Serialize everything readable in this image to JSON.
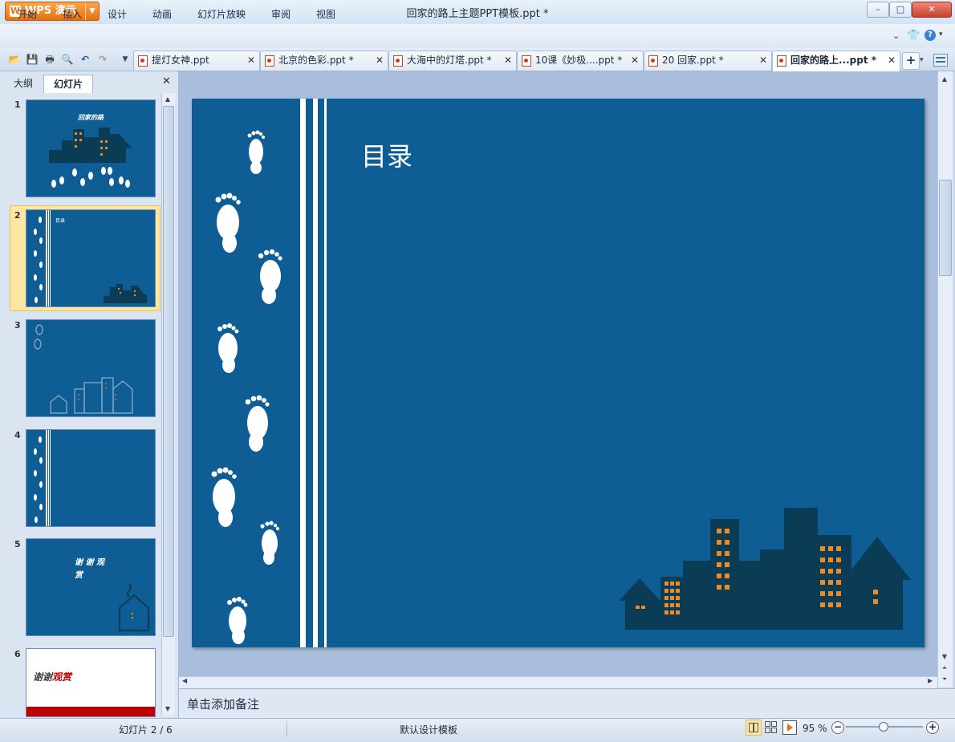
{
  "app": {
    "name": "WPS 演示",
    "window_title": "回家的路上主题PPT模板.ppt *"
  },
  "window_buttons": {
    "minimize": "–",
    "maximize": "□",
    "close": "✕"
  },
  "menu": [
    "开始",
    "插入",
    "设计",
    "动画",
    "幻灯片放映",
    "审阅",
    "视图"
  ],
  "doc_tabs": [
    {
      "label": "提灯女神.ppt",
      "active": false
    },
    {
      "label": "北京的色彩.ppt *",
      "active": false
    },
    {
      "label": "大海中的灯塔.ppt *",
      "active": false
    },
    {
      "label": "10课《妙极....ppt *",
      "active": false
    },
    {
      "label": "20 回家.ppt *",
      "active": false
    },
    {
      "label": "回家的路上...ppt *",
      "active": true
    }
  ],
  "panel": {
    "tab_outline": "大纲",
    "tab_slides": "幻灯片"
  },
  "thumbnails": [
    {
      "num": "1",
      "text": "回家的路"
    },
    {
      "num": "2",
      "text": "目录"
    },
    {
      "num": "3",
      "text": ""
    },
    {
      "num": "4",
      "text": ""
    },
    {
      "num": "5",
      "text": "谢 谢 观 赏"
    },
    {
      "num": "6",
      "text_plain": "谢谢",
      "text_accent": "观赏"
    }
  ],
  "selected_slide": 2,
  "slide": {
    "title": "目录"
  },
  "notes": {
    "placeholder": "单击添加备注"
  },
  "status": {
    "slide_count": "幻灯片 2 / 6",
    "template": "默认设计模板",
    "zoom": "95 %"
  },
  "colors": {
    "slide_bg": "#0f5d95",
    "building": "#0b3c55",
    "window_light": "#f08a24",
    "accent_red": "#c00000",
    "app_orange": "#e67112"
  },
  "icons": [
    "open-icon",
    "save-icon",
    "print-icon",
    "print-preview-icon",
    "undo-icon",
    "redo-icon",
    "dropdown-icon",
    "new-tab-icon",
    "skin-icon",
    "help-icon",
    "close-icon"
  ]
}
